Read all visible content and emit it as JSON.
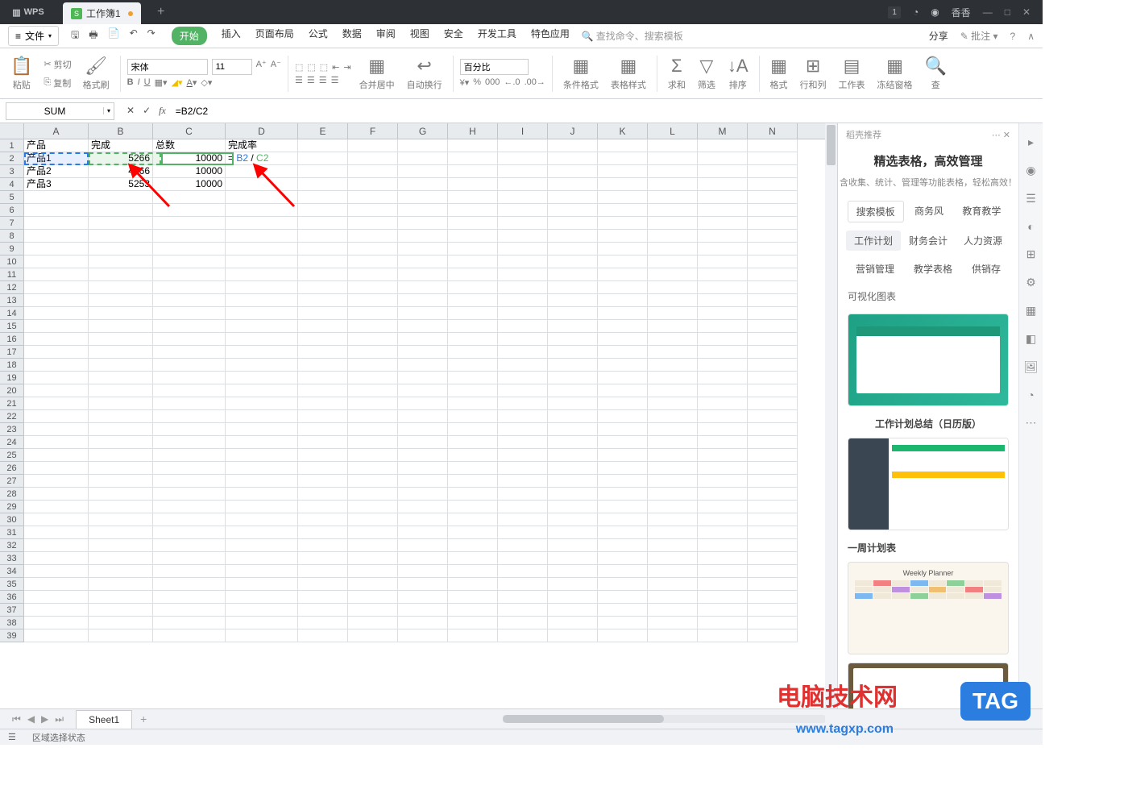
{
  "app": {
    "name": "WPS"
  },
  "tab": {
    "title": "工作簿1"
  },
  "titlebar_right": {
    "badge": "1",
    "user": "香香"
  },
  "menu": {
    "file": "文件",
    "tabs": [
      "开始",
      "插入",
      "页面布局",
      "公式",
      "数据",
      "审阅",
      "视图",
      "安全",
      "开发工具",
      "特色应用"
    ],
    "search": "查找命令、搜索模板",
    "share": "分享",
    "annotate": "批注"
  },
  "ribbon": {
    "paste": "粘贴",
    "cut": "剪切",
    "copy": "复制",
    "brush": "格式刷",
    "font": "宋体",
    "size": "11",
    "merge": "合并居中",
    "wrap": "自动换行",
    "numfmt": "百分比",
    "condfmt": "条件格式",
    "tablestyle": "表格样式",
    "sum": "求和",
    "filter": "筛选",
    "sort": "排序",
    "format": "格式",
    "rowscols": "行和列",
    "worksheet": "工作表",
    "freeze": "冻结窗格",
    "find": "查"
  },
  "formula_bar": {
    "name": "SUM",
    "formula": "=B2/C2"
  },
  "columns": [
    "A",
    "B",
    "C",
    "D",
    "E",
    "F",
    "G",
    "H",
    "I",
    "J",
    "K",
    "L",
    "M",
    "N"
  ],
  "rows_count": 39,
  "grid": {
    "headers": {
      "A": "产品",
      "B": "完成",
      "C": "总数",
      "D": "完成率"
    },
    "data": [
      {
        "A": "产品1",
        "B": "5266",
        "C": "10000",
        "D": "= B2 / C2"
      },
      {
        "A": "产品2",
        "B": "4266",
        "C": "10000",
        "D": ""
      },
      {
        "A": "产品3",
        "B": "5253",
        "C": "10000",
        "D": ""
      }
    ]
  },
  "right_panel": {
    "header": "稻壳推荐",
    "title": "精选表格，高效管理",
    "subtitle": "含收集、统计、管理等功能表格，轻松高效！",
    "search_ph": "搜索模板",
    "chips1": [
      "商务风",
      "教育教学"
    ],
    "chips2": [
      "工作计划",
      "财务会计",
      "人力资源"
    ],
    "chips3": [
      "营销管理",
      "教学表格",
      "供销存"
    ],
    "section": "可视化图表",
    "label2": "工作计划总结（日历版）",
    "label3": "一周计划表",
    "label3_en": "Weekly Planner"
  },
  "sheet": {
    "name": "Sheet1"
  },
  "status": {
    "text": "区域选择状态"
  },
  "watermark": {
    "text1": "电脑技术网",
    "tag": "TAG",
    "url": "www.tagxp.com"
  }
}
